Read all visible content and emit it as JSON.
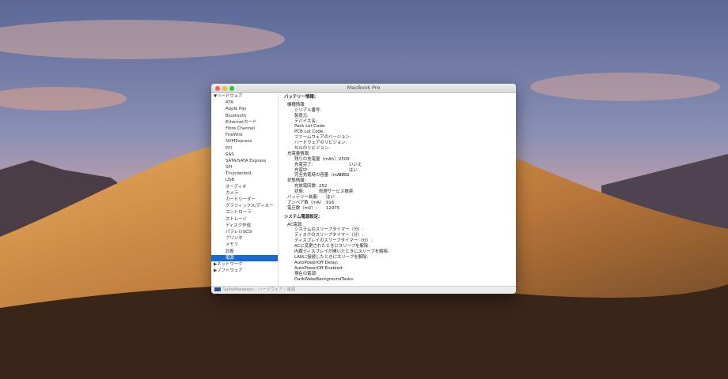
{
  "window": {
    "title": "MacBook Pro"
  },
  "sidebar": {
    "hardware": "▼ハードウェア",
    "items": [
      "ATA",
      "Apple Pay",
      "Bluetooth",
      "Ethernetカード",
      "Fibre Channel",
      "FireWire",
      "NVMExpress",
      "PCI",
      "SAS",
      "SATA/SATA Express",
      "SPI",
      "Thunderbolt",
      "USB",
      "オーディオ",
      "カメラ",
      "カードリーダー",
      "グラフィックス/ディスー",
      "コントローラ",
      "ストレージ",
      "ディスク作成",
      "パラレルSCSI",
      "プリンタ",
      "メモリ",
      "診断",
      "電源"
    ],
    "network": "▶ネットワーク",
    "software": "▶ソフトウェア"
  },
  "content": {
    "battery_title": "バッテリー情報:",
    "model_info": "機種情報:",
    "serial": "シリアル番号:",
    "manufacturer": "製造元:",
    "device_name": "デバイス名:",
    "pack_lot": "Pack Lot Code:",
    "pcb_lot": "PCB Lot Code:",
    "firmware": "ファームウェアのバージョン:",
    "hardware_rev": "ハードウェアのリビジョン:",
    "cell_rev": "セルのリビジョン:",
    "charge_info": "充電量情報:",
    "remaining": "残りの充電量（mAh）:",
    "remaining_v": "2509",
    "fully_charged": "充電完了:",
    "fully_charged_v": "いいえ",
    "charging": "充電中:",
    "charging_v": "はい",
    "full_capacity": "完全充電時の容量（mAh）:",
    "full_capacity_v": "2782",
    "health_info": "状態情報:",
    "cycle_count": "充放電回数:",
    "cycle_count_v": "252",
    "condition": "状態:",
    "condition_v": "修理サービス推奨",
    "installed": "バッテリー装着:",
    "installed_v": "はい",
    "amperage": "アンペア数（mA）:",
    "amperage_v": "916",
    "voltage": "電圧数（mV）:",
    "voltage_v": "12975",
    "power_title": "システム電源設定:",
    "ac_power": "AC電源:",
    "sys_sleep": "システムのスリープタイマー（分）:",
    "disk_sleep": "ディスクのスリープタイマー（分）:",
    "display_sleep": "ディスプレイのスリープタイマー（分）:",
    "wake_ac": "ACに変更されたときにスリープを解除:",
    "wake_lid": "内蔵ディスプレイが開いたときにスリープを解除:",
    "wake_lan": "LANに接続したときにスリープを解除:",
    "apo_delay": "AutoPowerOff Delay:",
    "apo_enabled": "AutoPowerOff Enabled:",
    "current_source": "現在の電源:",
    "darkwake": "DarkWakeBackgroundTasks:"
  },
  "statusbar": {
    "path": "SaitoMasakazu › ハードウェア › 電源"
  }
}
